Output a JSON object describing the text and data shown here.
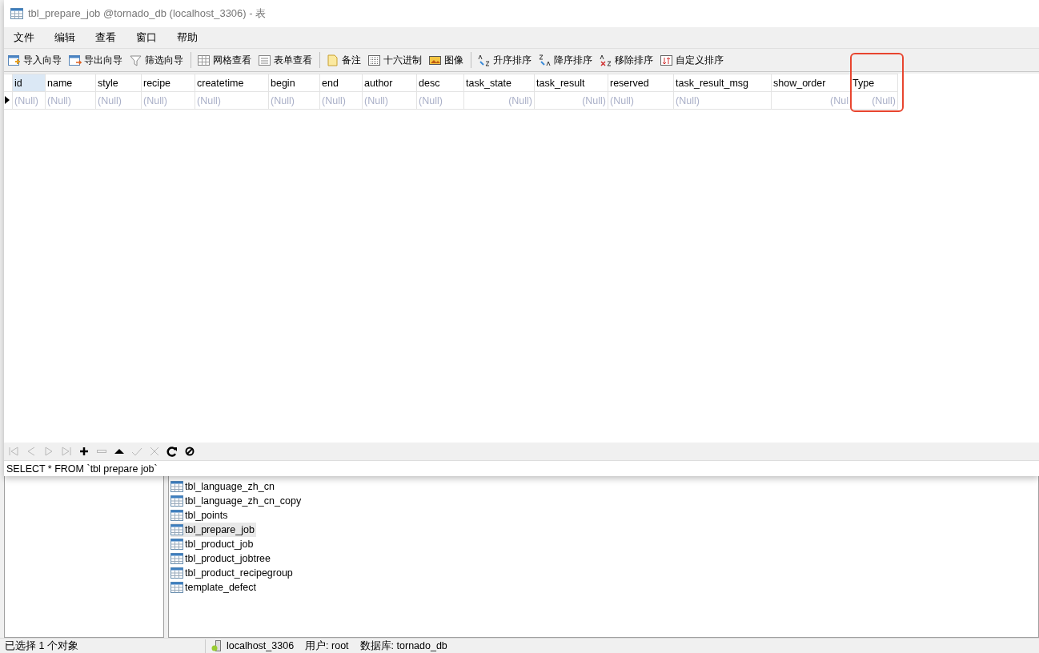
{
  "window": {
    "title": "tbl_prepare_job @tornado_db (localhost_3306) - 表"
  },
  "menu": [
    "文件",
    "编辑",
    "查看",
    "窗口",
    "帮助"
  ],
  "toolbar": [
    {
      "kind": "import",
      "label": "导入向导"
    },
    {
      "kind": "export",
      "label": "导出向导"
    },
    {
      "kind": "filter",
      "label": "筛选向导"
    },
    {
      "kind": "separator"
    },
    {
      "kind": "grid",
      "label": "网格查看"
    },
    {
      "kind": "form",
      "label": "表单查看"
    },
    {
      "kind": "separator"
    },
    {
      "kind": "memo",
      "label": "备注"
    },
    {
      "kind": "hex",
      "label": "十六进制"
    },
    {
      "kind": "image",
      "label": "图像"
    },
    {
      "kind": "separator"
    },
    {
      "kind": "sort-asc",
      "label": "升序排序"
    },
    {
      "kind": "sort-desc",
      "label": "降序排序"
    },
    {
      "kind": "sort-remove",
      "label": "移除排序"
    },
    {
      "kind": "sort-custom",
      "label": "自定义排序"
    }
  ],
  "table": {
    "columns": [
      {
        "name": "id",
        "kind": "text",
        "selected": true,
        "highlighted": false
      },
      {
        "name": "name",
        "kind": "text",
        "selected": false,
        "highlighted": false
      },
      {
        "name": "style",
        "kind": "text",
        "selected": false,
        "highlighted": false
      },
      {
        "name": "recipe",
        "kind": "text",
        "selected": false,
        "highlighted": false
      },
      {
        "name": "createtime",
        "kind": "text",
        "selected": false,
        "highlighted": false
      },
      {
        "name": "begin",
        "kind": "text",
        "selected": false,
        "highlighted": false
      },
      {
        "name": "end",
        "kind": "text",
        "selected": false,
        "highlighted": false
      },
      {
        "name": "author",
        "kind": "text",
        "selected": false,
        "highlighted": false
      },
      {
        "name": "desc",
        "kind": "text",
        "selected": false,
        "highlighted": false
      },
      {
        "name": "task_state",
        "kind": "number",
        "selected": false,
        "highlighted": false
      },
      {
        "name": "task_result",
        "kind": "number",
        "selected": false,
        "highlighted": false
      },
      {
        "name": "reserved",
        "kind": "text",
        "selected": false,
        "highlighted": false
      },
      {
        "name": "task_result_msg",
        "kind": "text",
        "selected": false,
        "highlighted": false
      },
      {
        "name": "show_order",
        "kind": "number",
        "selected": false,
        "highlighted": false
      },
      {
        "name": "Type",
        "kind": "number",
        "selected": false,
        "highlighted": true
      }
    ],
    "rows": [
      {
        "current": true,
        "cells": [
          "(Null)",
          "(Null)",
          "(Null)",
          "(Null)",
          "(Null)",
          "(Null)",
          "(Null)",
          "(Null)",
          "(Null)",
          "(Null)",
          "(Null)",
          "(Null)",
          "(Null)",
          "(Nul",
          "(Null)"
        ]
      }
    ]
  },
  "nav_buttons": [
    {
      "kind": "first",
      "disabled": true
    },
    {
      "kind": "prev",
      "disabled": true
    },
    {
      "kind": "next",
      "disabled": true
    },
    {
      "kind": "last",
      "disabled": true
    },
    {
      "kind": "add",
      "disabled": false
    },
    {
      "kind": "delete",
      "disabled": true
    },
    {
      "kind": "up",
      "disabled": false
    },
    {
      "kind": "apply",
      "disabled": true
    },
    {
      "kind": "cancel",
      "disabled": true
    },
    {
      "kind": "refresh",
      "disabled": false
    },
    {
      "kind": "stop",
      "disabled": false
    }
  ],
  "sql": "SELECT * FROM `tbl prepare job`",
  "objects": [
    {
      "name": "tbl_language_zh_cn",
      "selected": false
    },
    {
      "name": "tbl_language_zh_cn_copy",
      "selected": false
    },
    {
      "name": "tbl_points",
      "selected": false
    },
    {
      "name": "tbl_prepare_job",
      "selected": true
    },
    {
      "name": "tbl_product_job",
      "selected": false
    },
    {
      "name": "tbl_product_jobtree",
      "selected": false
    },
    {
      "name": "tbl_product_recipegroup",
      "selected": false
    },
    {
      "name": "template_defect",
      "selected": false
    }
  ],
  "status_bar": {
    "selection": "已选择 1 个对象",
    "connection": "localhost_3306",
    "user": "用户: root",
    "database": "数据库: tornado_db"
  }
}
